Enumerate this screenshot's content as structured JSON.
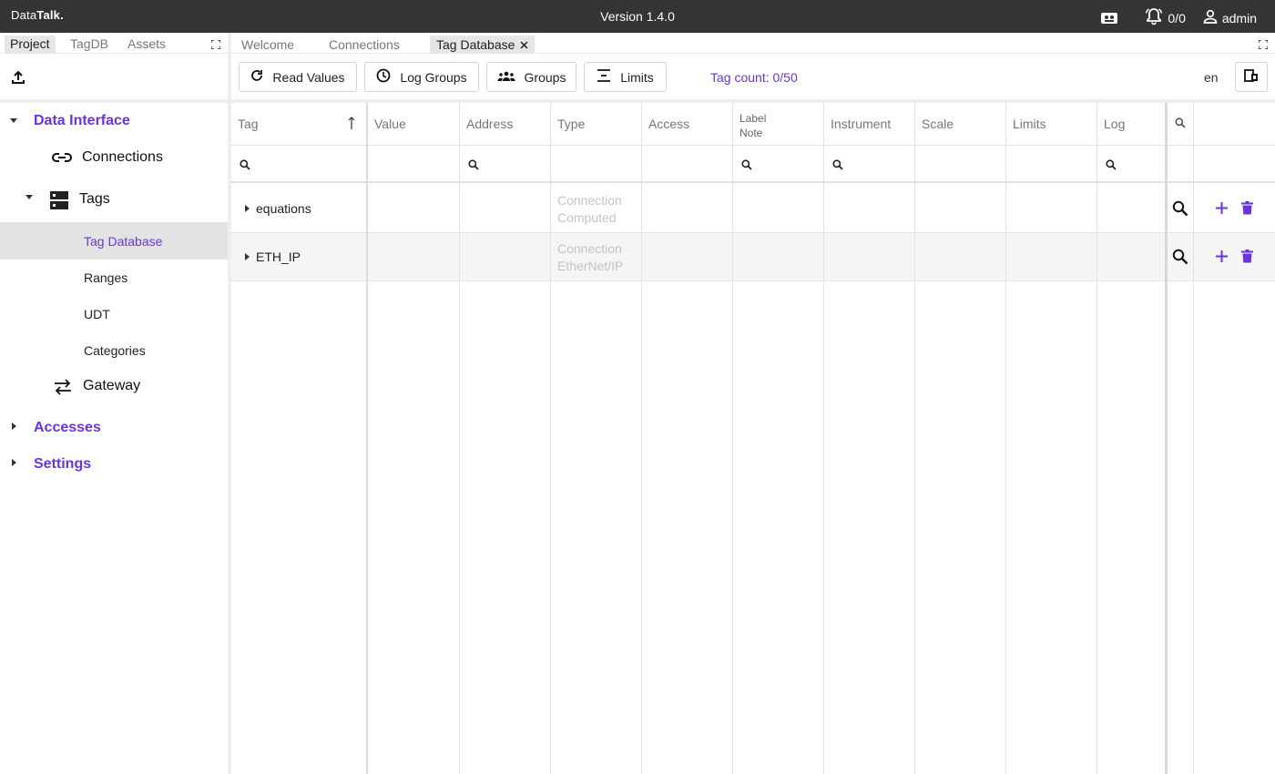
{
  "app": {
    "brand_prefix": "Data",
    "brand_bold": "Talk.",
    "version": "Version 1.4.0",
    "alarm_count": "0/0",
    "user": "admin"
  },
  "sidebar": {
    "tabs": [
      "Project",
      "TagDB",
      "Assets"
    ],
    "active_tab": "Project",
    "tree": {
      "data_interface": "Data Interface",
      "connections": "Connections",
      "tags": "Tags",
      "tag_database": "Tag Database",
      "ranges": "Ranges",
      "udt": "UDT",
      "categories": "Categories",
      "gateway": "Gateway",
      "accesses": "Accesses",
      "settings": "Settings"
    }
  },
  "main": {
    "tabs": [
      "Welcome",
      "Connections",
      "Tag Database"
    ],
    "active_tab": "Tag Database",
    "toolbar": {
      "read_values": "Read Values",
      "log_groups": "Log Groups",
      "groups": "Groups",
      "limits": "Limits",
      "tag_count": "Tag count: 0/50",
      "lang": "en"
    },
    "grid": {
      "headers": {
        "tag": "Tag",
        "value": "Value",
        "address": "Address",
        "type": "Type",
        "access": "Access",
        "label": "Label",
        "note": "Note",
        "instrument": "Instrument",
        "scale": "Scale",
        "limits": "Limits",
        "log": "Log"
      },
      "rows": [
        {
          "name": "equations",
          "type_line1": "Connection",
          "type_line2": "Computed"
        },
        {
          "name": "ETH_IP",
          "type_line1": "Connection",
          "type_line2": "EtherNet/IP"
        }
      ]
    }
  },
  "colors": {
    "accent": "#6a34e0",
    "topbar": "#343434"
  }
}
